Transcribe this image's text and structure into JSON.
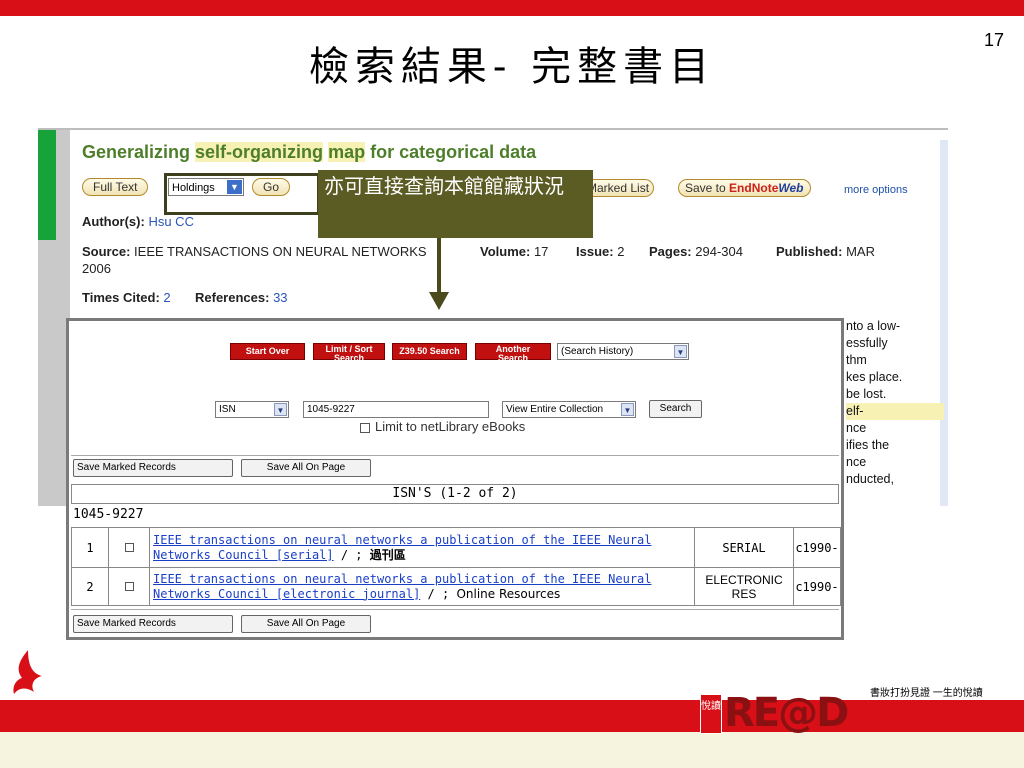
{
  "slide": {
    "title": "檢索結果- 完整書目",
    "page_number": "17"
  },
  "wos": {
    "title_parts": [
      "Generalizing ",
      "self-organizing",
      " ",
      "map",
      " for categorical data"
    ],
    "buttons": {
      "full_text": "Full Text",
      "holdings_select": "Holdings",
      "go": "Go",
      "marked_list": "Marked List",
      "save_to": "Save to",
      "endnote": "EndNote",
      "web": "Web",
      "more_options": "more options"
    },
    "author_label": "Author(s):",
    "author": "Hsu CC",
    "source_label": "Source:",
    "source": "IEEE TRANSACTIONS ON NEURAL NETWORKS",
    "volume_label": "Volume:",
    "volume": "17",
    "issue_label": "Issue:",
    "issue": "2",
    "pages_label": "Pages:",
    "pages": "294-304",
    "published_label": "Published:",
    "published": "MAR",
    "year": "2006",
    "times_cited_label": "Times Cited:",
    "times_cited": "2",
    "references_label": "References:",
    "references": "33",
    "abstract_fragments": [
      "nto a low-",
      "essfully",
      "thm",
      "kes place.",
      "be lost.",
      "elf-",
      "nce",
      "ifies the",
      "nce",
      "nducted,"
    ]
  },
  "callout": {
    "text": "亦可直接查詢本館館藏狀況"
  },
  "library": {
    "buttons": {
      "start_over": "Start Over",
      "limit_sort_1": "Limit / Sort",
      "limit_sort_2": "Search",
      "z3950": "Z39.50 Search",
      "another_1": "Another",
      "another_2": "Search",
      "search": "Search",
      "save_marked": "Save Marked Records",
      "save_all": "Save All On Page"
    },
    "search_history": "(Search History)",
    "index_select": "ISN",
    "query": "1045-9227",
    "collection_select": "View Entire Collection",
    "limit_netlibrary": "Limit to netLibrary eBooks",
    "results_header": "ISN'S (1-2 of 2)",
    "group_heading": "1045-9227",
    "results": [
      {
        "num": "1",
        "title_line1": "IEEE transactions on neural networks a publication of the IEEE Neural",
        "title_line2": "Networks Council [serial]",
        "suffix": " / ; ",
        "location": "過刊區",
        "format": "SERIAL",
        "date": "c1990-"
      },
      {
        "num": "2",
        "title_line1": "IEEE transactions on neural networks a publication of the IEEE Neural",
        "title_line2": "Networks Council [electronic journal]",
        "suffix": " / ; ",
        "location": "Online Resources",
        "format_line1": "ELECTRONIC",
        "format_line2": "RES",
        "date": "c1990-"
      }
    ]
  },
  "footer": {
    "slogan": "書妝打扮見證 一生的悅讀",
    "logo_text": "RE@D",
    "logo_side": "悅讀"
  },
  "colors": {
    "brand_red": "#d80f16",
    "callout_bg": "#5b5b24",
    "wos_green": "#4d7f2a"
  }
}
